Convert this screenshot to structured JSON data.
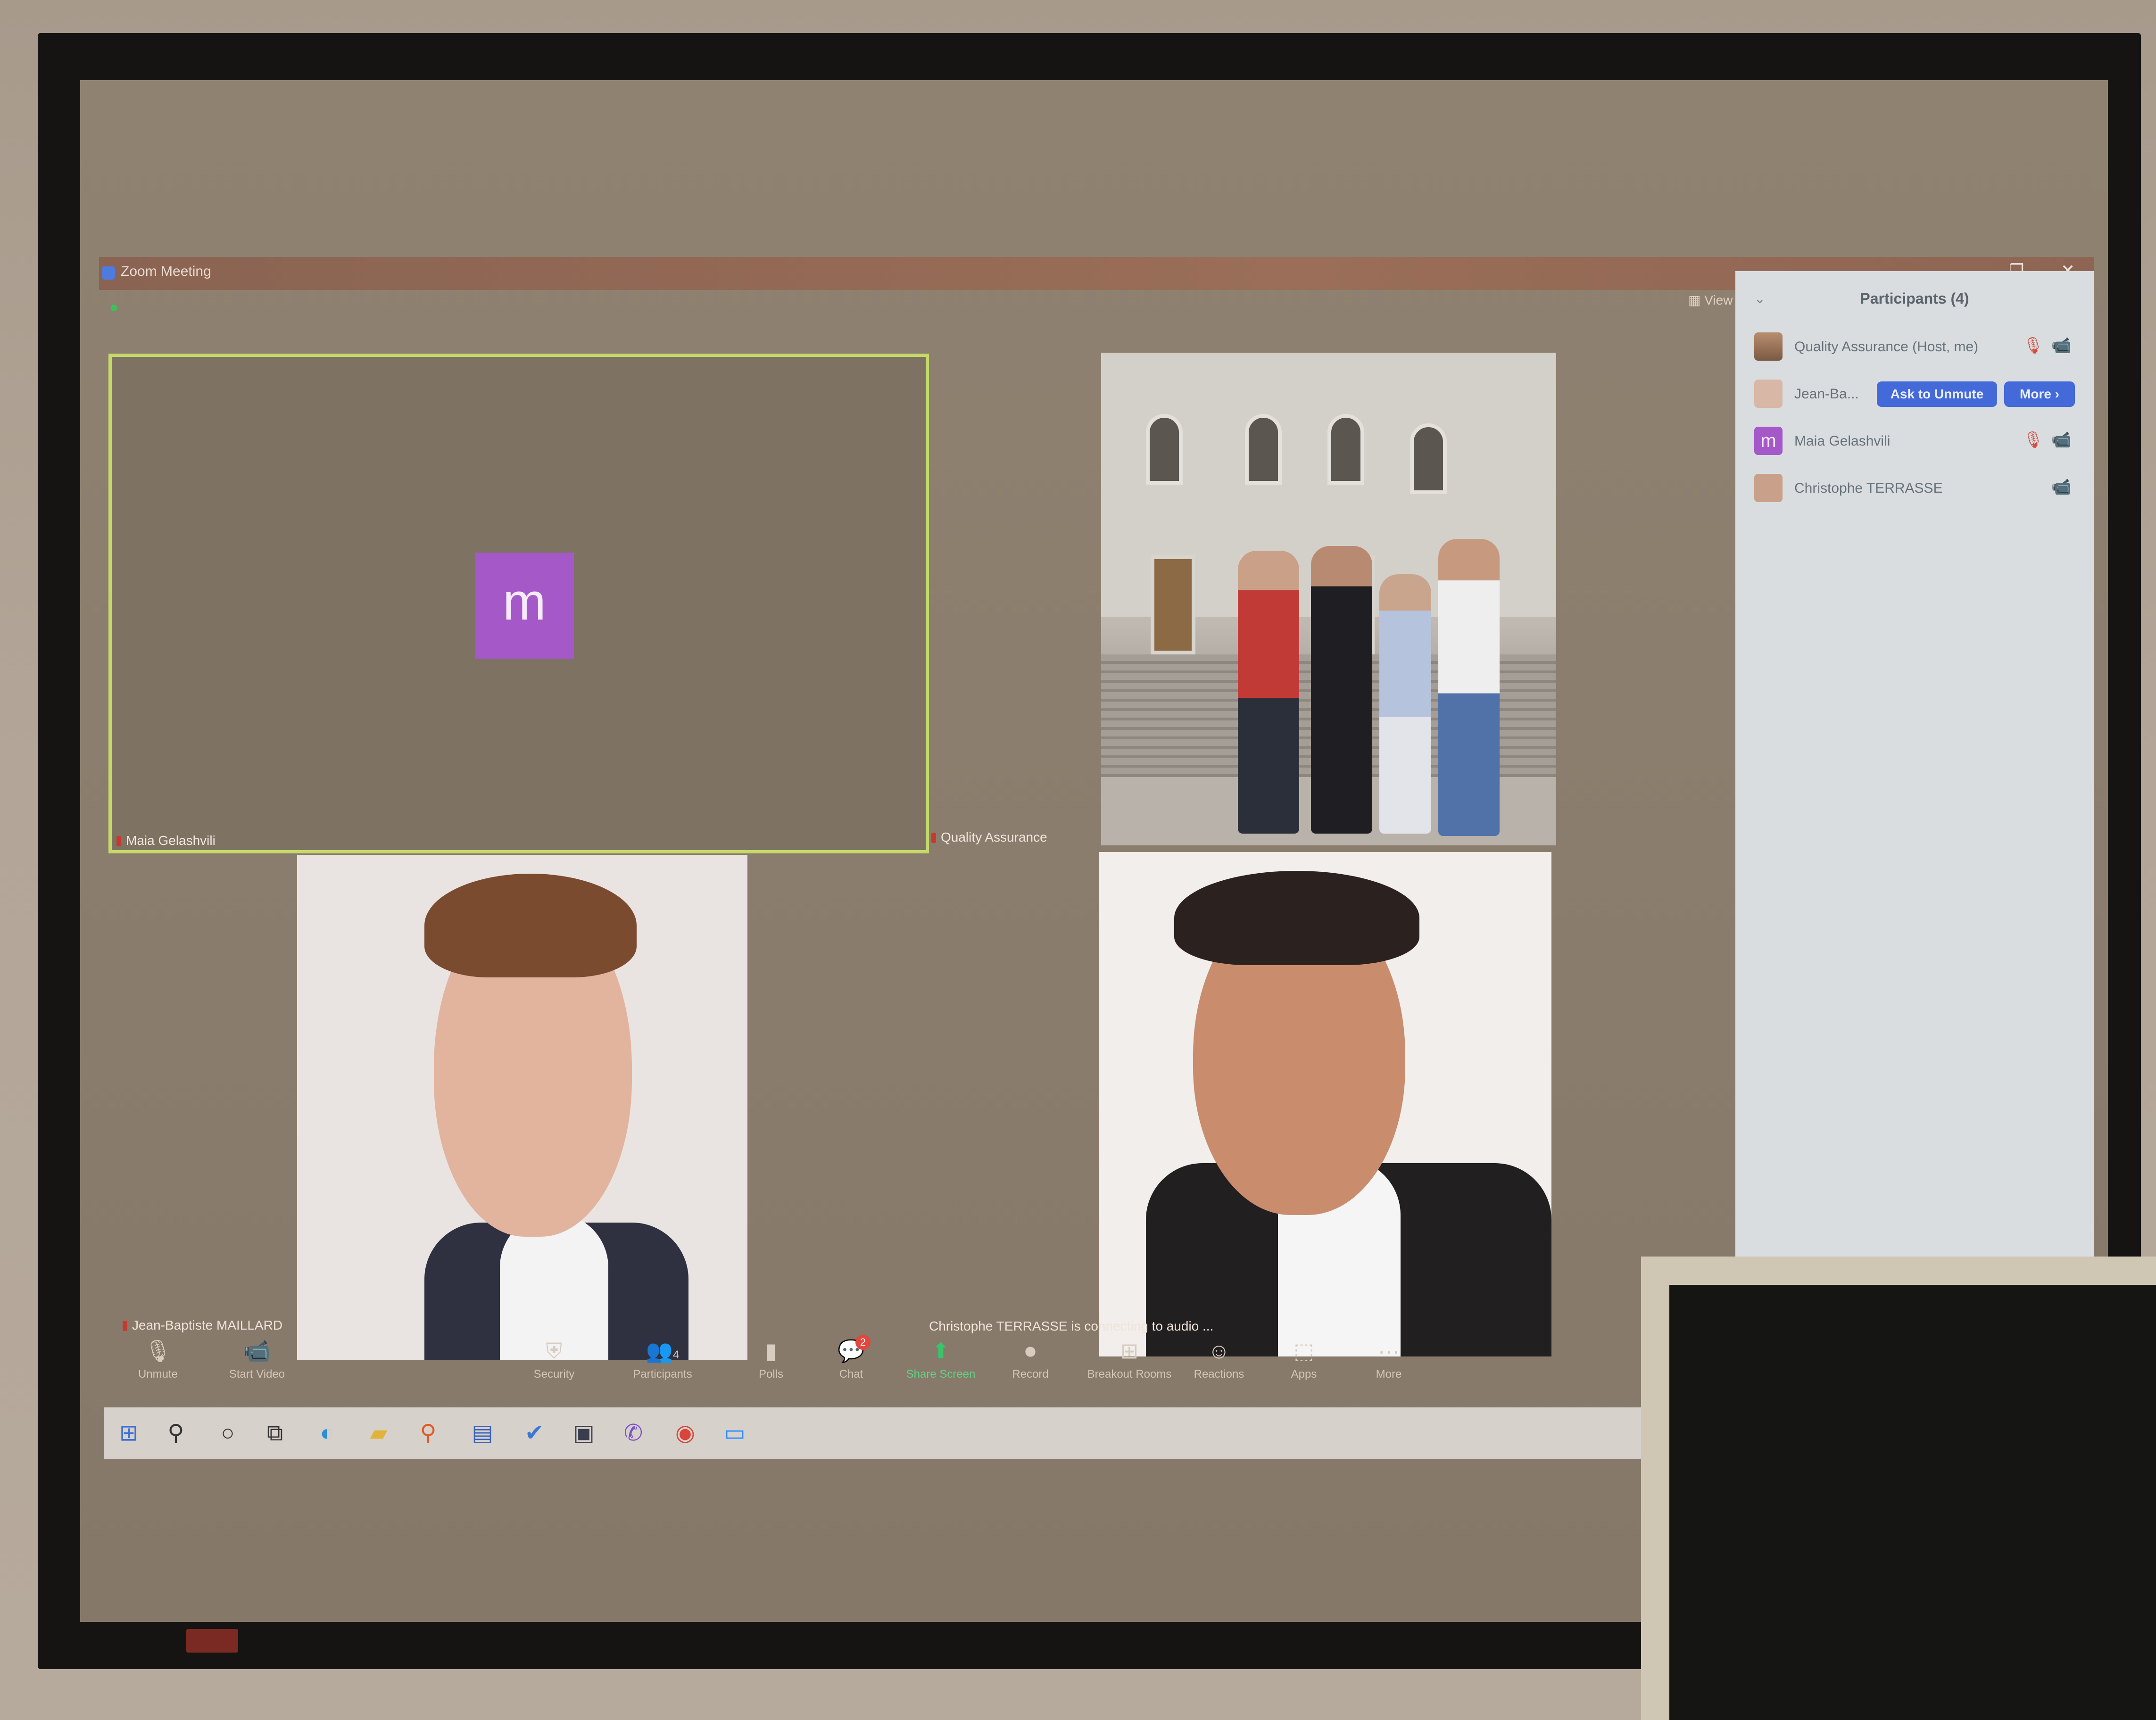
{
  "window": {
    "title": "Zoom Meeting",
    "minimize_glyph": "–",
    "restore_glyph": "❐",
    "close_glyph": "✕",
    "view_label": "View"
  },
  "tiles": {
    "maia": {
      "name": "Maia Gelashvili",
      "avatar_letter": "m",
      "active_speaker_color": "#c5d96a"
    },
    "quality_assurance": {
      "name": "Quality Assurance"
    },
    "jean_baptiste": {
      "name": "Jean-Baptiste MAILLARD"
    },
    "christophe": {
      "name": "Christophe TERRASSE"
    }
  },
  "connecting_note": "Christophe TERRASSE is connecting to audio ...",
  "toolbar": {
    "unmute": "Unmute",
    "start_video": "Start Video",
    "security": "Security",
    "participants": "Participants",
    "participants_count": "4",
    "polls": "Polls",
    "chat": "Chat",
    "chat_badge": "2",
    "share_screen": "Share Screen",
    "record": "Record",
    "breakout_rooms": "Breakout Rooms",
    "reactions": "Reactions",
    "apps": "Apps",
    "more": "More"
  },
  "taskbar": {
    "icons": [
      "windows-icon",
      "search-icon",
      "cortana-icon",
      "task-view-icon",
      "edge-icon",
      "file-explorer-icon",
      "search-app-icon",
      "calendar-icon",
      "todo-icon",
      "media-icon",
      "viber-icon",
      "chrome-icon",
      "zoom-icon"
    ]
  },
  "participants_panel": {
    "title": "Participants (4)",
    "rows": [
      {
        "name": "Quality Assurance (Host, me)"
      },
      {
        "name": "Jean-Ba...",
        "ask_to_unmute": "Ask to Unmute",
        "more": "More ›"
      },
      {
        "name": "Maia Gelashvili",
        "avatar_letter": "m"
      },
      {
        "name": "Christophe TERRASSE"
      }
    ],
    "accent_color": "#4469d8",
    "muted_color": "#d44a3e"
  }
}
